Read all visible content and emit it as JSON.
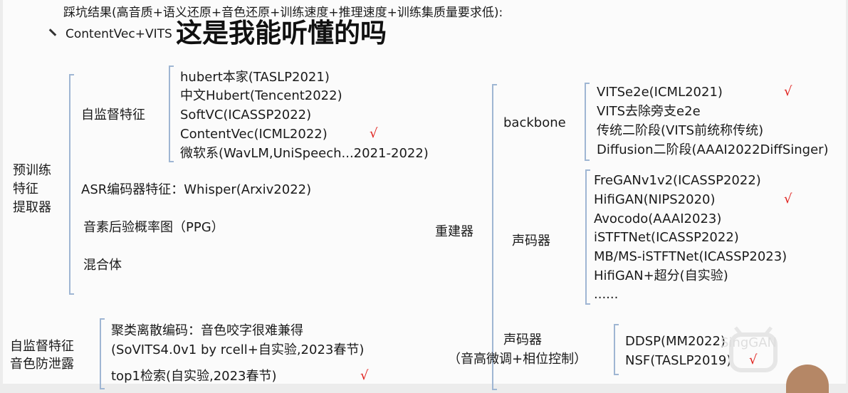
{
  "header": {
    "line1": "踩坑结果(高音质+语义还原+音色还原+训练速度+推理速度+训练集质量要求低):",
    "line2": "ContentVec+VITS",
    "subtitle": "这是我能听懂的吗"
  },
  "pretrain": {
    "label_lines": [
      "预训练",
      "特征",
      "提取器"
    ],
    "selfsup": {
      "label": "自监督特征",
      "items": [
        "hubert本家(TASLP2021)",
        "中文Hubert(Tencent2022)",
        "SoftVC(ICASSP2022)",
        "ContentVec(ICML2022)",
        "微软系(WavLM,UniSpeech...2021-2022)"
      ]
    },
    "asr": "ASR编码器特征：Whisper(Arxiv2022)",
    "ppg": "音素后验概率图（PPG）",
    "mix": "混合体"
  },
  "leak": {
    "label_lines": [
      "自监督特征",
      "音色防泄露"
    ],
    "items": [
      "聚类离散编码：音色咬字很难兼得",
      "(SoVITS4.0v1 by rcell+自实验,2023春节)",
      "top1检索(自实验,2023春节)"
    ]
  },
  "reconstructor": {
    "label": "重建器",
    "backbone": {
      "label": "backbone",
      "items": [
        "VITSe2e(ICML2021)",
        "VITS去除旁支e2e",
        "传统二阶段(VITS前统称传统)",
        "Diffusion二阶段(AAAI2022DiffSinger)"
      ]
    },
    "vocoder": {
      "label": "声码器",
      "items": [
        "FreGANv1v2(ICASSP2022)",
        "HifiGAN(NIPS2020)",
        "Avocodo(AAAI2023)",
        "iSTFTNet(ICASSP2022)",
        "MB/MS-iSTFTNet(ICASSP2023)",
        "HifiGAN+超分(自实验)",
        "......"
      ]
    },
    "vocoder2": {
      "label_lines": [
        "声码器",
        "（音高微调+相位控制）"
      ],
      "items": [
        "DDSP(MM2022)",
        "NSF(TASLP2019)"
      ]
    }
  },
  "check_mark": "√",
  "watermark": "SingGAN",
  "colors": {
    "check": "#e0201c",
    "brace": "#9fb6d3"
  }
}
